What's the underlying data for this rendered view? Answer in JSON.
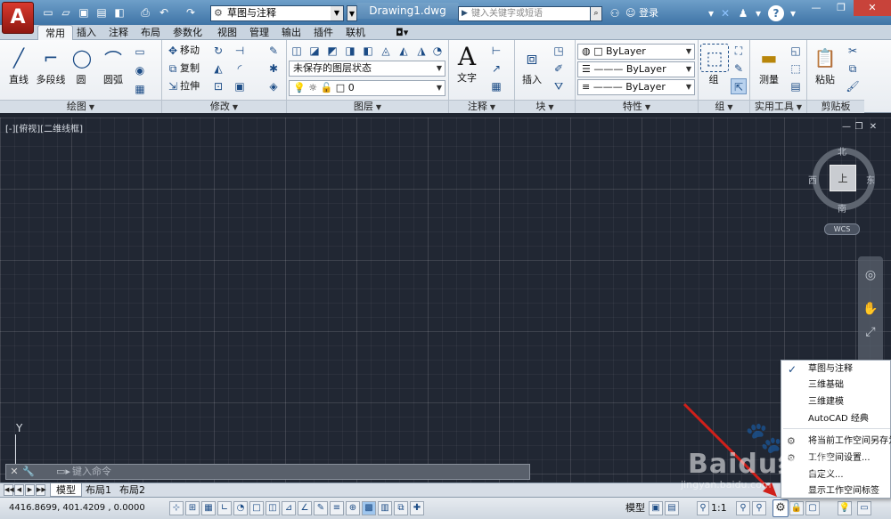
{
  "titlebar": {
    "app_button": "A",
    "workspace": "草图与注释",
    "document": "Drawing1.dwg",
    "search_placeholder": "键入关键字或短语",
    "login": "登录",
    "help": "?"
  },
  "ribbon_tabs": [
    "常用",
    "插入",
    "注释",
    "布局",
    "参数化",
    "视图",
    "管理",
    "输出",
    "插件",
    "联机"
  ],
  "panels": {
    "draw": {
      "title": "绘图",
      "line": "直线",
      "polyline": "多段线",
      "circle": "圆",
      "arc": "圆弧"
    },
    "modify": {
      "title": "修改",
      "move": "移动",
      "copy": "复制",
      "stretch": "拉伸"
    },
    "layers": {
      "title": "图层",
      "layer_state": "未保存的图层状态",
      "current_layer": "0"
    },
    "annotation": {
      "title": "注释",
      "text": "文字"
    },
    "block": {
      "title": "块",
      "insert": "插入"
    },
    "properties": {
      "title": "特性",
      "color": "ByLayer",
      "linetype": "ByLayer",
      "lineweight": "ByLayer"
    },
    "groups": {
      "title": "组",
      "group": "组"
    },
    "utilities": {
      "title": "实用工具",
      "measure": "测量"
    },
    "clipboard": {
      "title": "剪贴板",
      "paste": "粘贴"
    }
  },
  "viewport": {
    "label": "[-][俯视][二维线框]",
    "compass": {
      "north": "北",
      "south": "南",
      "east": "东",
      "west": "西",
      "top": "上"
    },
    "wcs": "WCS",
    "ucs_y": "Y"
  },
  "command_line": {
    "placeholder": "键入命令"
  },
  "layout_tabs": [
    "模型",
    "布局1",
    "布局2"
  ],
  "status": {
    "coords": "4416.8699, 401.4209 , 0.0000",
    "model": "模型",
    "scale": "1:1"
  },
  "workspace_menu": {
    "items": [
      "草图与注释",
      "三维基础",
      "三维建模",
      "AutoCAD 经典"
    ],
    "checked_index": 0,
    "actions": [
      "将当前工作空间另存为...",
      "工作空间设置...",
      "自定义...",
      "显示工作空间标签"
    ]
  },
  "watermark": {
    "text": "Baidu经验",
    "url_text": "jingyan.baidu.com"
  },
  "colors": {
    "accent": "#3f74a6",
    "canvas": "#212733",
    "annotation_arrow": "#d0201a"
  }
}
